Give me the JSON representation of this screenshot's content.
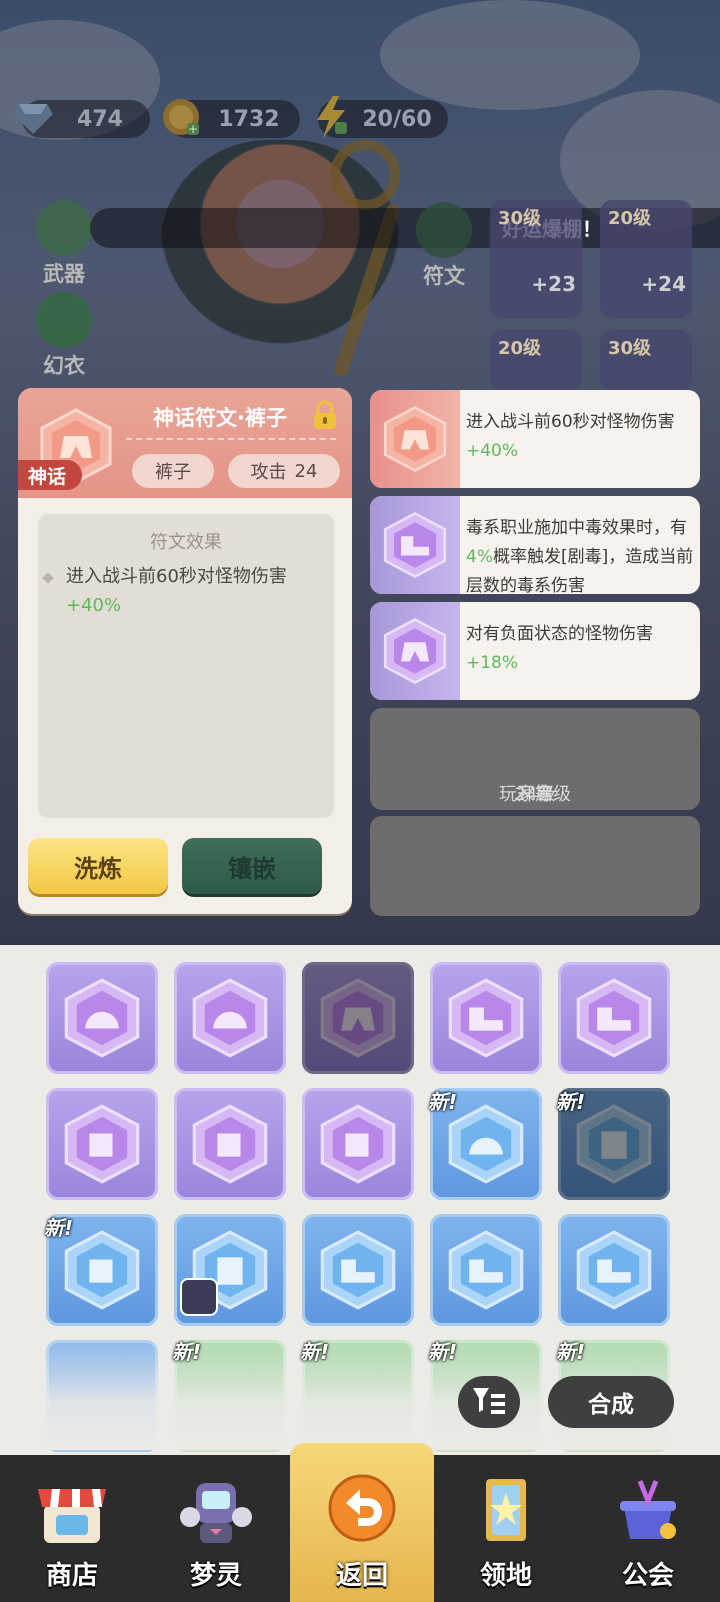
{
  "resources": [
    {
      "icon": "diamond-icon",
      "value": "474"
    },
    {
      "icon": "gold-coin-icon",
      "value": "1732"
    },
    {
      "icon": "lightning-energy-icon",
      "value": "20/60"
    }
  ],
  "side_menu": {
    "weapon": "武器",
    "skin": "幻衣",
    "rune": "符文"
  },
  "ticker_text": "好运爆棚！",
  "equipment": [
    {
      "level": "30级",
      "count": "+23"
    },
    {
      "level": "20级",
      "count": "+24"
    },
    {
      "level": "20级",
      "count": ""
    },
    {
      "level": "30级",
      "count": ""
    }
  ],
  "detail": {
    "title": "神话符文·裤子",
    "tier": "神话",
    "slot_type": "裤子",
    "stat_label": "攻击",
    "stat_value": "24",
    "effect_title": "符文效果",
    "effect_text": "进入战斗前60秒对怪物伤害",
    "effect_value": "+40%",
    "refine_label": "洗炼",
    "inlay_label": "镶嵌"
  },
  "slots": [
    {
      "rarity": "myth",
      "text_a": "进入战斗前60秒对怪物伤害",
      "value": "+40%"
    },
    {
      "rarity": "epic",
      "text_a": "毒系职业施加中毒效果时，有",
      "value": "4%",
      "text_b": "概率触发[剧毒]，造成当前层数的毒系伤害"
    },
    {
      "rarity": "epic",
      "text_a": "对有负面状态的怪物伤害",
      "value": "+18%"
    }
  ],
  "locked_slot": {
    "prefix": "玩家等级",
    "level": "24级",
    "suffix": "开启"
  },
  "inventory": {
    "new_label": "新!",
    "compose_label": "合成"
  },
  "nav": [
    {
      "label": "商店",
      "icon": "shop-icon"
    },
    {
      "label": "梦灵",
      "icon": "dream-spirit-icon"
    },
    {
      "label": "返回",
      "icon": "return-arrow-icon"
    },
    {
      "label": "领地",
      "icon": "territory-icon"
    },
    {
      "label": "公会",
      "icon": "guild-icon"
    }
  ],
  "colors": {
    "myth": "#e9908a",
    "epic": "#a897d8",
    "rare": "#6fa6e6",
    "uncommon": "#95ce95",
    "accent_green": "#5fb85a",
    "accent_red": "#e5504a"
  }
}
